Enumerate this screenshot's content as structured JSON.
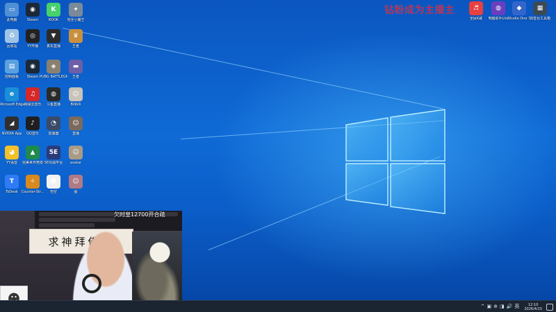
{
  "banner": {
    "text": "钻粉成为主播主"
  },
  "webcam": {
    "gift_text": "欠时皇12700开合疏",
    "calligraphy": "求神拜佛没"
  },
  "desktop_icons": [
    {
      "id": "ic-1",
      "label": "此电脑",
      "icon": "computer-icon",
      "color": "#4f8fd6",
      "glyph": "▭"
    },
    {
      "id": "ic-2",
      "label": "Steam",
      "icon": "steam-icon",
      "color": "#1b2838",
      "glyph": "◉"
    },
    {
      "id": "ic-3",
      "label": "KOOK",
      "icon": "kook-icon",
      "color": "#47d16c",
      "glyph": "K"
    },
    {
      "id": "ic-4",
      "label": "完全小魔王",
      "icon": "game-icon",
      "color": "#7a8a9a",
      "glyph": "✦"
    },
    {
      "id": "ic-5",
      "label": "回收站",
      "icon": "recycle-bin-icon",
      "color": "#9ec3e6",
      "glyph": "♻"
    },
    {
      "id": "ic-6",
      "label": "YY开播",
      "icon": "yy-live-icon",
      "color": "#222222",
      "glyph": "◎"
    },
    {
      "id": "ic-7",
      "label": "真实直播",
      "icon": "live-app-icon",
      "color": "#2b2b2b",
      "glyph": "▼"
    },
    {
      "id": "ic-8",
      "label": "王者",
      "icon": "game-icon",
      "color": "#c98f3e",
      "glyph": "♛"
    },
    {
      "id": "ic-9",
      "label": "控制面板",
      "icon": "control-panel-icon",
      "color": "#5aa0e0",
      "glyph": "▤"
    },
    {
      "id": "ic-10",
      "label": "Steam",
      "icon": "steam-icon",
      "color": "#1b2838",
      "glyph": "◉"
    },
    {
      "id": "ic-11",
      "label": "PUBG BATTLEGR...",
      "icon": "pubg-icon",
      "color": "#8a8070",
      "glyph": "◈"
    },
    {
      "id": "ic-12",
      "label": "王者",
      "icon": "shortcut-icon",
      "color": "#6d5ea8",
      "glyph": "▬"
    },
    {
      "id": "ic-13",
      "label": "Microsoft Edge",
      "icon": "edge-icon",
      "color": "#1a8fd8",
      "glyph": "e"
    },
    {
      "id": "ic-14",
      "label": "网易云音乐",
      "icon": "netease-music-icon",
      "color": "#d62828",
      "glyph": "♫"
    },
    {
      "id": "ic-15",
      "label": "斗鱼直播",
      "icon": "douyu-icon",
      "color": "#2a2a2a",
      "glyph": "◍"
    },
    {
      "id": "ic-16",
      "label": "Bilibili",
      "icon": "portrait-icon",
      "color": "#c8c3bb",
      "glyph": "☺"
    },
    {
      "id": "ic-17",
      "label": "NVIDIA App",
      "icon": "nvidia-icon",
      "color": "#2f2f2f",
      "glyph": "◢"
    },
    {
      "id": "ic-18",
      "label": "QQ音乐",
      "icon": "qq-music-icon",
      "color": "#1f1f1f",
      "glyph": "♪"
    },
    {
      "id": "ic-19",
      "label": "加速器",
      "icon": "accelerator-icon",
      "color": "#394b68",
      "glyph": "◔"
    },
    {
      "id": "ic-20",
      "label": "直播",
      "icon": "portrait-icon",
      "color": "#7a6a5e",
      "glyph": "☺"
    },
    {
      "id": "ic-21",
      "label": "YY语音",
      "icon": "yy-voice-icon",
      "color": "#f3c02a",
      "glyph": "◕"
    },
    {
      "id": "ic-22",
      "label": "完美世界竞技",
      "icon": "perfect-world-icon",
      "color": "#1e8a4c",
      "glyph": "▲"
    },
    {
      "id": "ic-23",
      "label": "5E对战平台",
      "icon": "5e-icon",
      "color": "#2a3a7a",
      "glyph": "5E"
    },
    {
      "id": "ic-24",
      "label": "avatar",
      "icon": "portrait-icon",
      "color": "#a99b86",
      "glyph": "☺"
    },
    {
      "id": "ic-25",
      "label": "ToDesk",
      "icon": "todesk-icon",
      "color": "#2f7bf5",
      "glyph": "T"
    },
    {
      "id": "ic-26",
      "label": "Counter-Str...",
      "icon": "cs-icon",
      "color": "#d88a1f",
      "glyph": "✧"
    },
    {
      "id": "ic-27",
      "label": "悟空",
      "icon": "goku-icon",
      "color": "#f2f2f2",
      "glyph": "☻"
    },
    {
      "id": "ic-28",
      "label": "图",
      "icon": "portrait-icon",
      "color": "#b07a86",
      "glyph": "☺"
    }
  ],
  "top_right_icons": [
    {
      "id": "tr-1",
      "label": "全民K歌",
      "icon": "kge-icon",
      "color": "#e84040",
      "glyph": "♬"
    },
    {
      "id": "tr-2",
      "label": "电脑助手Lite",
      "icon": "assistant-icon",
      "color": "#6a3fbf",
      "glyph": "◍"
    },
    {
      "id": "tr-3",
      "label": "Studio One 7",
      "icon": "studio-one-icon",
      "color": "#3366cc",
      "glyph": "◆"
    },
    {
      "id": "tr-4",
      "label": "调音台工具箱",
      "icon": "toolbox-icon",
      "color": "#3b4a55",
      "glyph": "▦"
    }
  ],
  "taskbar": {
    "tray_icons": [
      "^",
      "▣",
      "⊕",
      "◨",
      "🔊",
      "英"
    ],
    "time": "12:10",
    "date": "2026/4/15"
  }
}
